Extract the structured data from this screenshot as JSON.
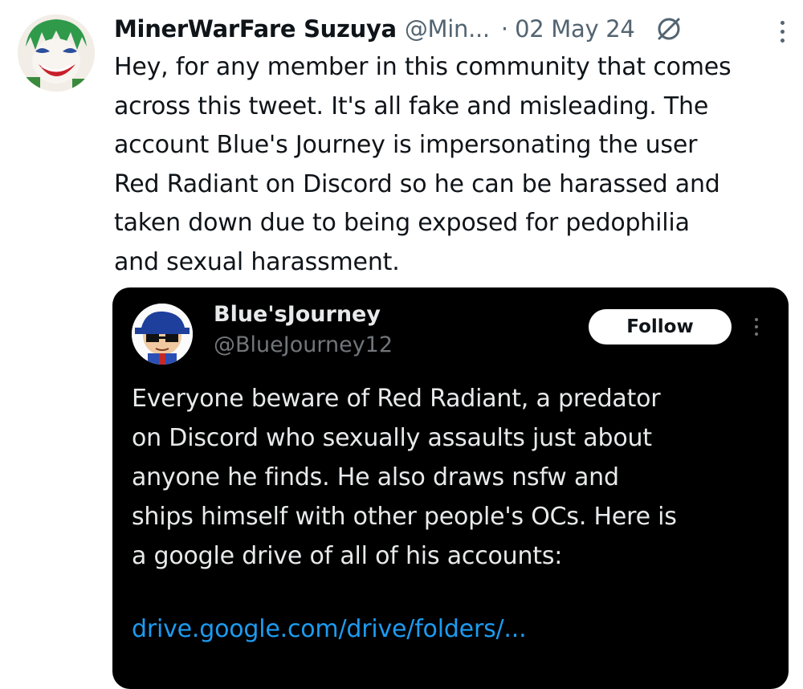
{
  "tweet": {
    "display_name": "MinerWarFare Suzuya",
    "handle": "@Min...",
    "separator": "·",
    "date": "02 May 24",
    "text_lines": [
      "Hey, for any member in this community that comes",
      "across this tweet. It's all fake and misleading. The",
      "account Blue's Journey is impersonating the user",
      "Red Radiant on Discord so he can be harassed and",
      "taken down due to being exposed for pedophilia",
      "and sexual harassment."
    ],
    "icons": {
      "avatar": "avatar",
      "visibility": "no-entry-circle-icon",
      "more": "more-vertical-icon"
    }
  },
  "quote": {
    "display_name": "Blue'sJourney",
    "handle": "@BlueJourney12",
    "follow_label": "Follow",
    "text_lines": [
      "Everyone beware of Red Radiant, a predator",
      "on Discord who sexually assaults just about",
      "anyone he finds. He also draws nsfw and",
      "ships himself with other people's OCs. Here is",
      "a google drive of all of his accounts:"
    ],
    "link": "drive.google.com/drive/folders/...",
    "icons": {
      "avatar": "avatar",
      "more": "more-vertical-icon"
    }
  },
  "colors": {
    "background": "#ffffff",
    "text_primary": "#0f1419",
    "text_secondary": "#536471",
    "quote_background": "#000000",
    "quote_text": "#e7e9ea",
    "quote_handle": "#71767b",
    "link": "#1d9bf0"
  }
}
